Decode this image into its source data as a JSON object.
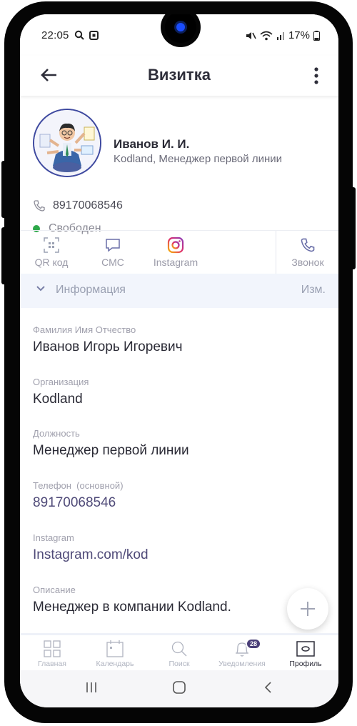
{
  "status_bar": {
    "time": "22:05",
    "battery": "17%"
  },
  "app_bar": {
    "title": "Визитка"
  },
  "profile": {
    "name": "Иванов И. И.",
    "subtitle": "Kodland, Менеджер первой линии",
    "phone": "89170068546",
    "status": "Свободен"
  },
  "actions": [
    {
      "label": "QR код",
      "icon": "qr-code-icon"
    },
    {
      "label": "СМС",
      "icon": "message-icon"
    },
    {
      "label": "Instagram",
      "icon": "instagram-icon"
    },
    {
      "label": "Звонок",
      "icon": "phone-icon"
    }
  ],
  "info_section": {
    "label": "Информация",
    "edit_label": "Изм."
  },
  "fields": [
    {
      "caption": "Фамилия Имя Отчество",
      "value": "Иванов Игорь Игоревич"
    },
    {
      "caption": "Организация",
      "value": "Kodland"
    },
    {
      "caption": "Должность",
      "value": "Менеджер первой линии"
    },
    {
      "caption": "Телефон  (основной)",
      "value": "89170068546"
    },
    {
      "caption": "Instagram",
      "value": "Instagram.com/kod"
    },
    {
      "caption": "Описание",
      "value": "Менеджер в компании Kodland."
    }
  ],
  "tabs": [
    {
      "label": "Главная",
      "icon": "grid-icon"
    },
    {
      "label": "Календарь",
      "icon": "calendar-icon"
    },
    {
      "label": "Поиск",
      "icon": "search-icon"
    },
    {
      "label": "Уведомления",
      "icon": "bell-icon",
      "badge": "28"
    },
    {
      "label": "Профиль",
      "icon": "profile-card-icon"
    }
  ],
  "colors": {
    "accent": "#4f4a78",
    "status_online": "#2ea84a",
    "info_bg": "#f2f5fc"
  }
}
